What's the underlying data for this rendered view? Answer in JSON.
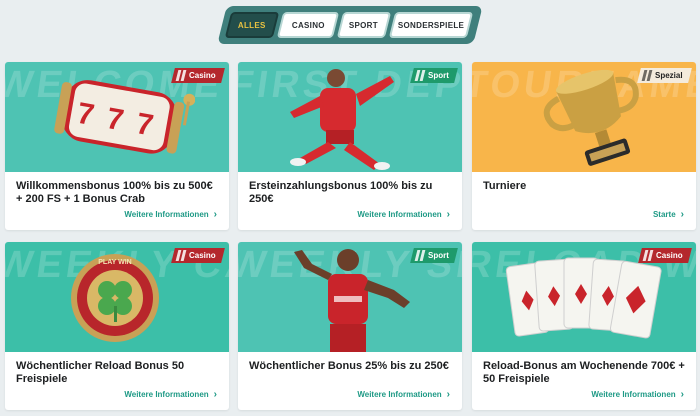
{
  "tabs": [
    {
      "label": "ALLES",
      "active": true
    },
    {
      "label": "CASINO",
      "active": false
    },
    {
      "label": "SPORT",
      "active": false
    },
    {
      "label": "SONDERSPIELE",
      "active": false
    }
  ],
  "colors": {
    "accent": "#1f9a86",
    "tab_active_bg": "#234e4b",
    "tab_active_text": "#e9c241",
    "casino_badge": "#b4282d",
    "sport_badge": "#1e9a6b"
  },
  "cards": [
    {
      "badge": "Casino",
      "background_text": "WELCOME CASINO",
      "title": "Willkommensbonus 100% bis zu 500€ + 200 FS + 1 Bonus Crab",
      "link": "Weitere Informationen",
      "art": "slot-reel-777"
    },
    {
      "badge": "Sport",
      "background_text": "FIRST DEPOSIT",
      "title": "Ersteinzahlungsbonus 100% bis zu 250€",
      "link": "Weitere Informationen",
      "art": "soccer-player"
    },
    {
      "badge": "Spezial",
      "background_text": "TOURNAMENT",
      "title": "Turniere",
      "link": "Starte",
      "art": "trophy"
    },
    {
      "badge": "Casino",
      "background_text": "WEEKLY CASINO",
      "title": "Wöchentlicher Reload Bonus 50 Freispiele",
      "link": "Weitere Informationen",
      "art": "clover-coin"
    },
    {
      "badge": "Sport",
      "background_text": "WEEKLY SPORT",
      "title": "Wöchentlicher Bonus 25% bis zu 250€",
      "link": "Weitere Informationen",
      "art": "athlete"
    },
    {
      "badge": "Casino",
      "background_text": "RELOAD WEEKEND",
      "title": "Reload-Bonus am Wochenende 700€ + 50 Freispiele",
      "link": "Weitere Informationen",
      "art": "playing-cards"
    }
  ],
  "art_labels": {
    "coin_text": "PLAY WIN"
  }
}
